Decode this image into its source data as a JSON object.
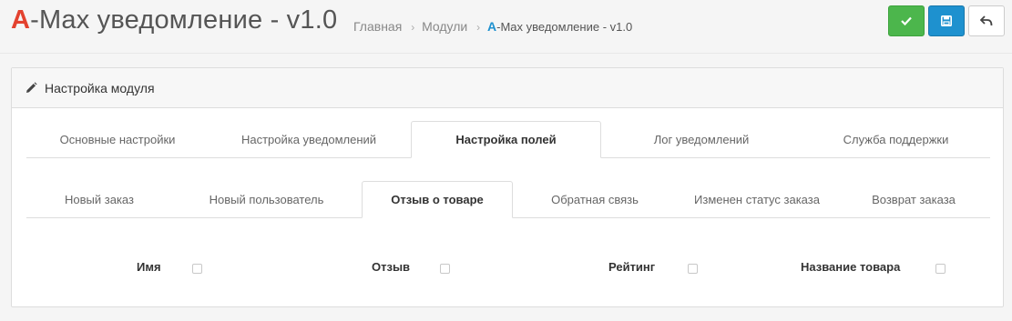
{
  "header": {
    "title_brand": "A",
    "title_rest": "-Max уведомление - v1.0",
    "breadcrumb": {
      "home": "Главная",
      "modules": "Модули",
      "current_brand": "A",
      "current_rest": "-Max уведомление - v1.0"
    },
    "buttons": [
      {
        "icon": "check-icon",
        "color": "#4cb64c"
      },
      {
        "icon": "save-icon",
        "color": "#1e91cf"
      },
      {
        "icon": "reply-icon",
        "color": "#ffffff"
      }
    ]
  },
  "panel": {
    "heading_icon": "pencil-icon",
    "heading": "Настройка модуля",
    "main_tabs": [
      {
        "label": "Основные настройки",
        "active": false
      },
      {
        "label": "Настройка уведомлений",
        "active": false
      },
      {
        "label": "Настройка полей",
        "active": true
      },
      {
        "label": "Лог уведомлений",
        "active": false
      },
      {
        "label": "Служба поддержки",
        "active": false
      }
    ],
    "sub_tabs": [
      {
        "label": "Новый заказ",
        "active": false
      },
      {
        "label": "Новый пользователь",
        "active": false
      },
      {
        "label": "Отзыв о товаре",
        "active": true
      },
      {
        "label": "Обратная связь",
        "active": false
      },
      {
        "label": "Изменен статус заказа",
        "active": false
      },
      {
        "label": "Возврат заказа",
        "active": false
      }
    ],
    "fields": [
      {
        "label": "Имя",
        "checked": false
      },
      {
        "label": "Отзыв",
        "checked": false
      },
      {
        "label": "Рейтинг",
        "checked": false
      },
      {
        "label": "Название товара",
        "checked": false
      }
    ]
  }
}
